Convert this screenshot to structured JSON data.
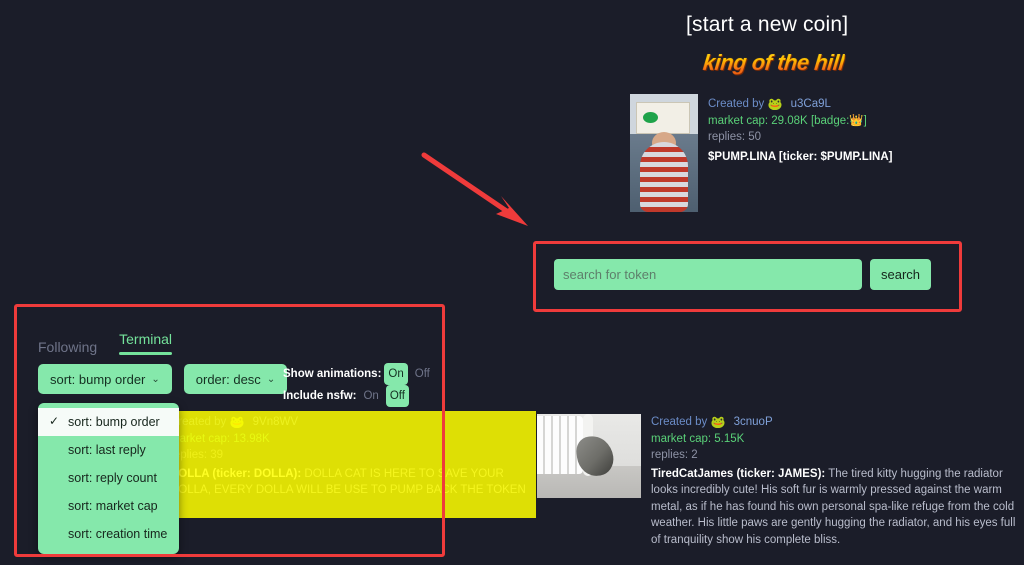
{
  "theme": {
    "background": "#1b1d29",
    "accent_green": "#85e8ab",
    "tab_active": "#74e39b",
    "annotation_red": "#ef3b3b",
    "highlight_yellow": "#ffff00",
    "mcap_green": "#5ad178",
    "created_by_blue": "#7fa0d8"
  },
  "header": {
    "start_new_coin": "[start a new coin]",
    "king_of_the_hill": "king of the hill"
  },
  "king_of_the_hill_card": {
    "thumbnail_alt": "woman holding pump.lina sign",
    "created_by_label": "Created by",
    "creator_emoji": "🐸",
    "creator": "u3Ca9L",
    "market_cap_label": "market cap:",
    "market_cap": "29.08K",
    "badge_text": "[badge:",
    "badge_emoji": "👑",
    "badge_close": "]",
    "replies_label": "replies:",
    "replies": "50",
    "title": "$PUMP.LINA [ticker: $PUMP.LINA]"
  },
  "search": {
    "placeholder": "search for token",
    "value": "",
    "button_label": "search"
  },
  "terminal": {
    "tabs": [
      {
        "label": "Following",
        "active": false
      },
      {
        "label": "Terminal",
        "active": true
      }
    ],
    "sort_button": "sort: bump order",
    "order_button": "order: desc",
    "chevron": "⌄",
    "toggles": [
      {
        "label": "Show animations:",
        "on_label": "On",
        "off_label": "Off",
        "state": "On"
      },
      {
        "label": "Include nsfw:",
        "on_label": "On",
        "off_label": "Off",
        "state": "Off"
      }
    ],
    "sort_menu": {
      "check_glyph": "✓",
      "items": [
        {
          "label": "sort: bump order",
          "selected": true
        },
        {
          "label": "sort: last reply",
          "selected": false
        },
        {
          "label": "sort: reply count",
          "selected": false
        },
        {
          "label": "sort: market cap",
          "selected": false
        },
        {
          "label": "sort: creation time",
          "selected": false
        }
      ]
    }
  },
  "coin_feed": [
    {
      "id": "dolla",
      "thumbnail_alt": "",
      "created_by_label": "Created by",
      "creator_emoji": "🐸",
      "creator": "9Vn8WV",
      "market_cap_label": "market cap:",
      "market_cap": "13.98K",
      "replies_label": "replies:",
      "replies": "39",
      "title": "DOLLA (ticker: DOLLA):",
      "description": "DOLLA CAT IS HERE TO SAVE YOUR DOLLA, EVERY DOLLA WILL BE USE TO PUMP BACK THE TOKEN"
    },
    {
      "id": "james",
      "thumbnail_alt": "cat hugging a radiator",
      "created_by_label": "Created by",
      "creator_emoji": "🐸",
      "creator": "3cnuoP",
      "market_cap_label": "market cap:",
      "market_cap": "5.15K",
      "replies_label": "replies:",
      "replies": "2",
      "title": "TiredCatJames (ticker: JAMES):",
      "description": "The tired kitty hugging the radiator looks incredibly cute! His soft fur is warmly pressed against the warm metal, as if he has found his own personal spa-like refuge from the cold weather. His little paws are gently hugging the radiator, and his eyes full of tranquility show his complete bliss."
    }
  ],
  "annotations": {
    "search_box_highlight": "red rectangle around search row",
    "terminal_panel_highlight": "red rectangle around terminal controls",
    "arrow": "red arrow pointing to search box"
  }
}
